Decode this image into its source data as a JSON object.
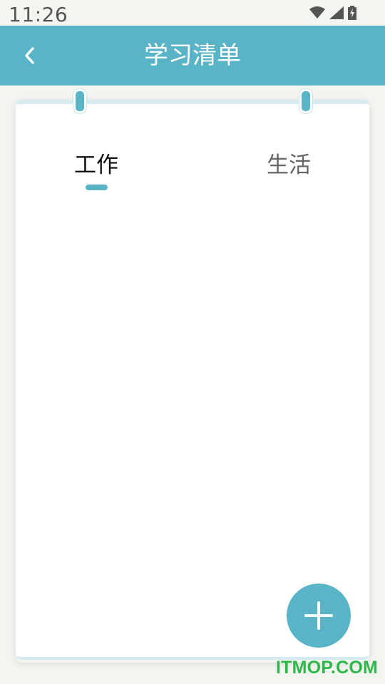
{
  "status_bar": {
    "time": "11:26",
    "icons": [
      "wifi-icon",
      "signal-icon",
      "battery-charging-icon"
    ]
  },
  "app_bar": {
    "title": "学习清单",
    "back_icon": "chevron-left-icon"
  },
  "tabs": [
    {
      "label": "工作",
      "selected": true
    },
    {
      "label": "生活",
      "selected": false
    }
  ],
  "fab": {
    "icon": "plus-icon"
  },
  "watermark": "ITMOP.COM",
  "colors": {
    "accent": "#5ab4c8",
    "background": "#f4f4f1",
    "card": "#ffffff",
    "tab_selected": "#111111",
    "tab_unselected": "#666666",
    "watermark": "#2db84a"
  }
}
